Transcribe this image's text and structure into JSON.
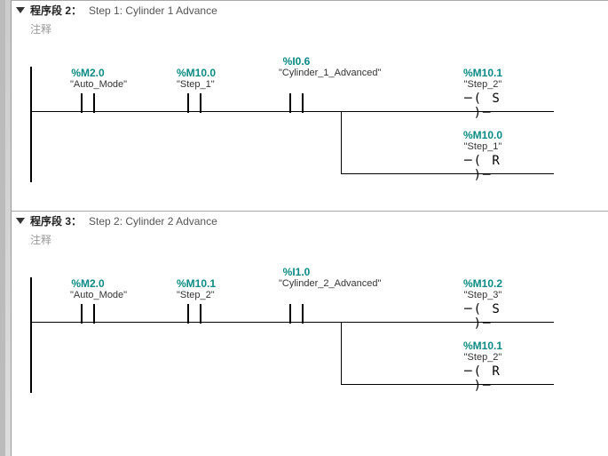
{
  "networks": [
    {
      "header_label": "程序段 2：",
      "description": "Step 1: Cylinder 1 Advance",
      "comment_label": "注释",
      "contacts": [
        {
          "addr": "%M2.0",
          "symbol": "\"Auto_Mode\""
        },
        {
          "addr": "%M10.0",
          "symbol": "\"Step_1\""
        },
        {
          "addr": "%I0.6",
          "symbol": "\"Cylinder_1_Advanced\""
        }
      ],
      "coils": [
        {
          "addr": "%M10.1",
          "symbol": "\"Step_2\"",
          "type": "S"
        },
        {
          "addr": "%M10.0",
          "symbol": "\"Step_1\"",
          "type": "R"
        }
      ]
    },
    {
      "header_label": "程序段 3：",
      "description": "Step 2: Cylinder 2 Advance",
      "comment_label": "注释",
      "contacts": [
        {
          "addr": "%M2.0",
          "symbol": "\"Auto_Mode\""
        },
        {
          "addr": "%M10.1",
          "symbol": "\"Step_2\""
        },
        {
          "addr": "%I1.0",
          "symbol": "\"Cylinder_2_Advanced\""
        }
      ],
      "coils": [
        {
          "addr": "%M10.2",
          "symbol": "\"Step_3\"",
          "type": "S"
        },
        {
          "addr": "%M10.1",
          "symbol": "\"Step_2\"",
          "type": "R"
        }
      ]
    }
  ]
}
